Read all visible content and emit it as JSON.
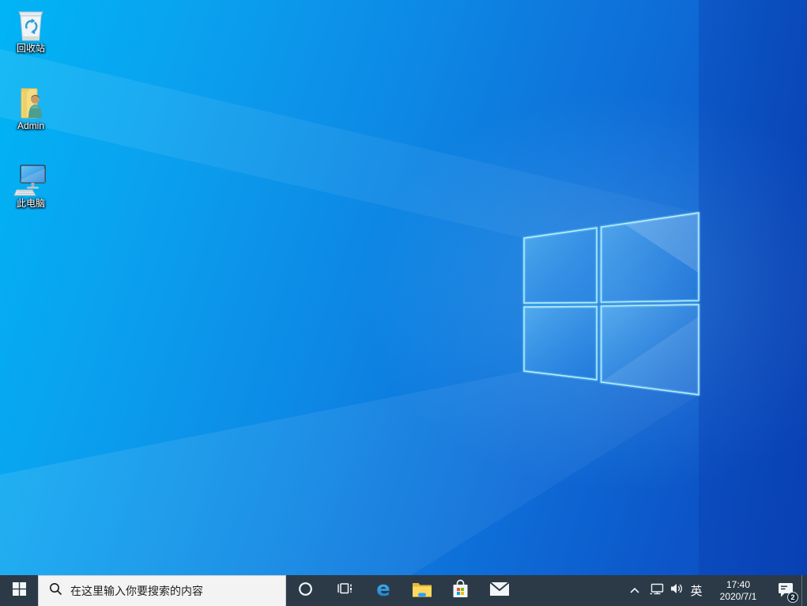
{
  "desktop": {
    "icons": [
      {
        "id": "recycle-bin",
        "label": "回收站"
      },
      {
        "id": "admin",
        "label": "Admin"
      },
      {
        "id": "this-pc",
        "label": "此电脑"
      }
    ]
  },
  "taskbar": {
    "start": {
      "icon": "windows-logo"
    },
    "search": {
      "placeholder": "在这里输入你要搜索的内容",
      "icon": "search-magnifier"
    },
    "app_buttons": [
      {
        "id": "cortana",
        "icon": "cortana-ring"
      },
      {
        "id": "task-view",
        "icon": "task-view"
      },
      {
        "id": "edge",
        "icon": "edge-e",
        "glyph": "e"
      },
      {
        "id": "file-explorer",
        "icon": "folder"
      },
      {
        "id": "microsoft-store",
        "icon": "store-bag"
      },
      {
        "id": "mail",
        "icon": "envelope"
      }
    ],
    "tray": {
      "hidden_icons": {
        "icon": "chevron-up"
      },
      "network": {
        "icon": "wired-network"
      },
      "volume": {
        "icon": "speaker"
      },
      "ime": "英",
      "clock": {
        "time": "17:40",
        "date": "2020/7/1"
      },
      "notifications": {
        "icon": "action-center-bubble",
        "count": "2"
      }
    }
  },
  "colors": {
    "taskbar_bg": "#2b3a46",
    "search_bg": "#f3f3f3",
    "wallpaper_left": "#00b5f5",
    "wallpaper_right": "#0a4cc0",
    "logo_edge_glow": "#9ff0ff",
    "store_red": "#f25022",
    "store_green": "#7fba00",
    "store_blue": "#00a4ef",
    "store_yellow": "#ffb900"
  }
}
